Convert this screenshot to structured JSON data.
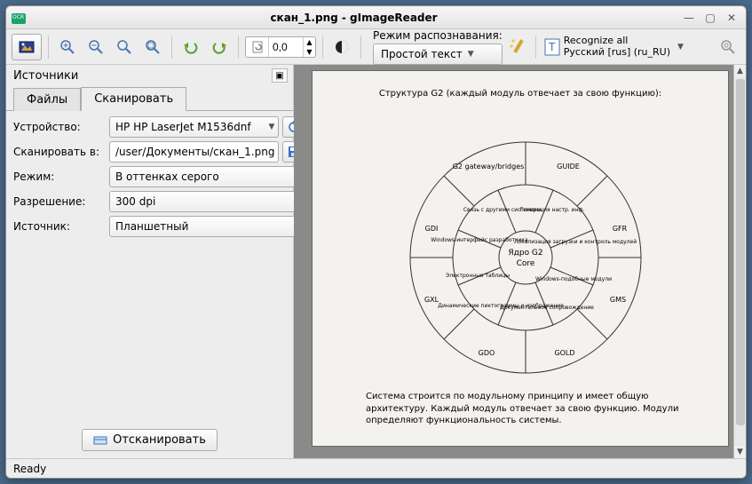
{
  "window": {
    "title": "скан_1.png - gImageReader"
  },
  "toolbar": {
    "rotation_value": "0,0",
    "recognition_mode_label": "Режим распознавания:",
    "recognition_mode_value": "Простой текст",
    "recognize_all_label": "Recognize all",
    "language_label": "Русский [rus] (ru_RU)"
  },
  "sidebar": {
    "title": "Источники",
    "tabs": {
      "files": "Файлы",
      "scan": "Сканировать"
    },
    "device_label": "Устройство:",
    "device_value": "HP HP LaserJet M1536dnf",
    "output_label": "Сканировать в:",
    "output_value": "/user/Документы/скан_1.png",
    "mode_label": "Режим:",
    "mode_value": "В оттенках серого",
    "resolution_label": "Разрешение:",
    "resolution_value": "300 dpi",
    "source_label": "Источник:",
    "source_value": "Планшетный",
    "scan_button": "Отсканировать"
  },
  "document": {
    "title": "Структура G2 (каждый модуль отвечает за свою функцию):",
    "core_line1": "Ядро G2",
    "core_line2": "Core",
    "outer": [
      "G2 gateway/bridges",
      "GUIDE",
      "GFR",
      "GMS",
      "GOLD",
      "GDO",
      "GXL",
      "GDI"
    ],
    "inner": [
      "Связь с другими системами",
      "Генерация настр. инф.",
      "Локализация загрузки и контроль модулей",
      "Windows-подобные модули",
      "Документальное сопровождение",
      "Динамические пиктограммы и изображения",
      "Электронные таблицы",
      "Windows-интерфейс разработчика"
    ],
    "body": "Система строится по модульному принципу и имеет общую архитектуру. Каждый модуль отвечает за свою функцию. Модули определяют функциональность системы."
  },
  "status": {
    "text": "Ready"
  }
}
